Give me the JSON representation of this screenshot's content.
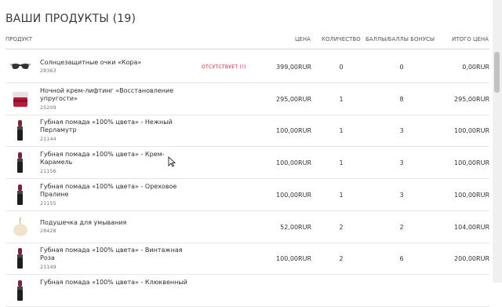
{
  "title": "ВАШИ ПРОДУКТЫ (19)",
  "columns": {
    "product": "ПРОДУКТ",
    "price": "ЦЕНА",
    "quantity": "КОЛИЧЕСТВО",
    "points": "БАЛЛЫ/БАЛЛЫ БОНУСЫ",
    "total": "ИТОГО ЦЕНА"
  },
  "products": [
    {
      "name": "Солнцезащитные очки «Кора»",
      "sku": "28363",
      "status": "ОТСУТСТВУЕТ (!)",
      "price": "399,00RUR",
      "qty": "0",
      "points": "0",
      "total": "0,00RUR",
      "icon": "sunglasses-icon"
    },
    {
      "name": "Ночной крем-лифтинг «Восстановление упругости»",
      "sku": "25209",
      "status": "",
      "price": "295,00RUR",
      "qty": "1",
      "points": "8",
      "total": "295,00RUR",
      "icon": "cream-jar-icon"
    },
    {
      "name": "Губная помада «100% цвета» - Нежный Перламутр",
      "sku": "21144",
      "status": "",
      "price": "100,00RUR",
      "qty": "1",
      "points": "3",
      "total": "100,00RUR",
      "icon": "lipstick-icon"
    },
    {
      "name": "Губная помада «100% цвета» - Крем-Карамель",
      "sku": "21156",
      "status": "",
      "price": "100,00RUR",
      "qty": "1",
      "points": "3",
      "total": "100,00RUR",
      "icon": "lipstick-icon"
    },
    {
      "name": "Губная помада «100% цвета» - Ореховое Пралине",
      "sku": "21155",
      "status": "",
      "price": "100,00RUR",
      "qty": "1",
      "points": "3",
      "total": "100,00RUR",
      "icon": "lipstick-icon"
    },
    {
      "name": "Подушечка для умывания",
      "sku": "28428",
      "status": "",
      "price": "52,00RUR",
      "qty": "2",
      "points": "2",
      "total": "104,00RUR",
      "icon": "sponge-icon"
    },
    {
      "name": "Губная помада «100% цвета» - Винтажная Роза",
      "sku": "21149",
      "status": "",
      "price": "100,00RUR",
      "qty": "2",
      "points": "6",
      "total": "200,00RUR",
      "icon": "lipstick-icon"
    },
    {
      "name": "Губная помада «100% цвета» - Клюквенный",
      "sku": "",
      "status": "",
      "price": "",
      "qty": "",
      "points": "",
      "total": "",
      "icon": "lipstick-icon"
    }
  ],
  "colors": {
    "status_red": "#d0192b",
    "row_divider": "#e6e6e6"
  }
}
